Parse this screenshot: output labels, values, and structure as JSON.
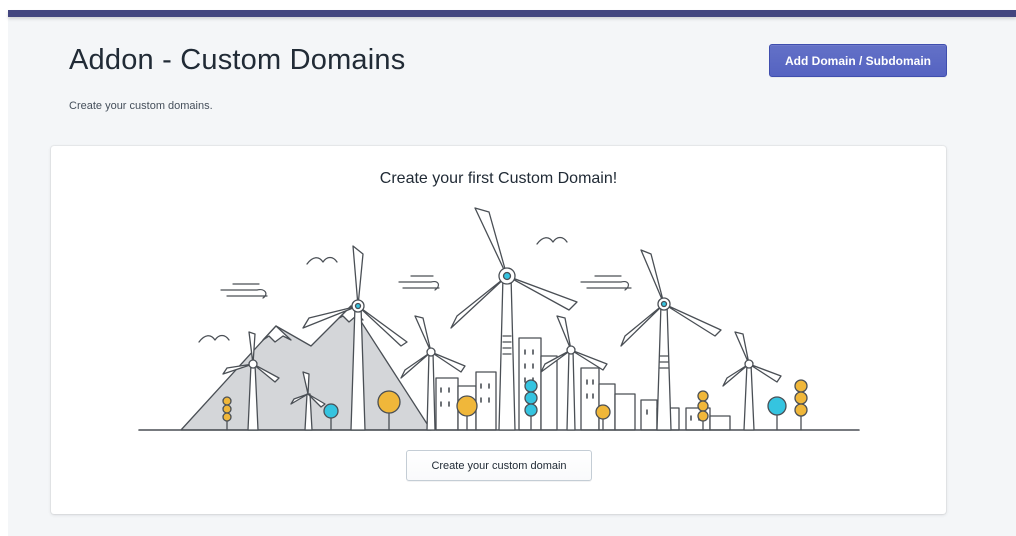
{
  "header": {
    "title": "Addon - Custom Domains",
    "subtitle": "Create your custom domains.",
    "add_button_label": "Add Domain / Subdomain"
  },
  "empty_state": {
    "heading": "Create your first Custom Domain!",
    "illustration_icon": "wind-turbines-cityscape-illustration",
    "cta_label": "Create your custom domain"
  },
  "colors": {
    "top_bar": "#43467f",
    "primary": "#5c6ac4",
    "background": "#f4f6f8",
    "accent_yellow": "#f0b73a",
    "accent_teal": "#35c4e0"
  }
}
